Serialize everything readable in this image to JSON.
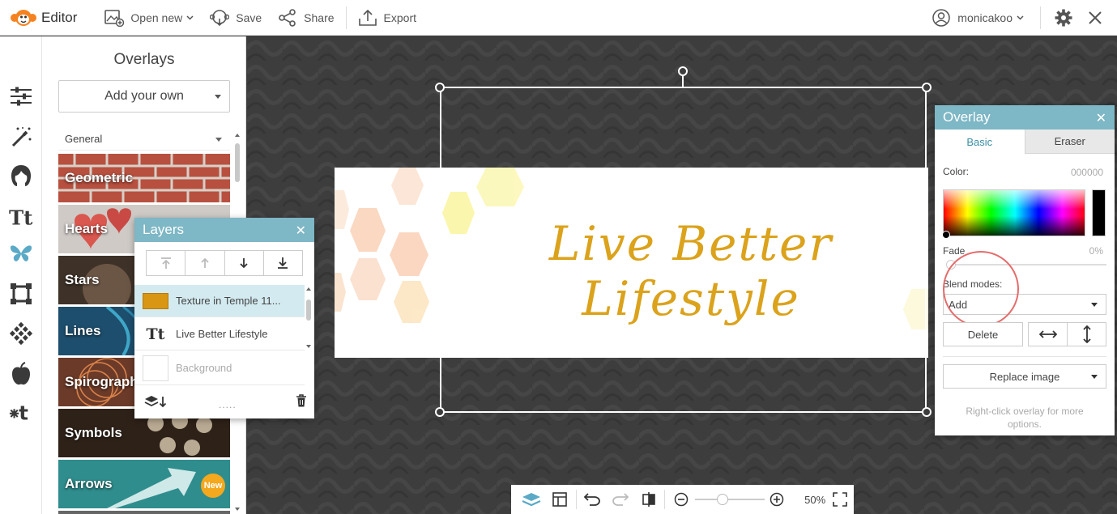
{
  "app": {
    "name": "Editor"
  },
  "toolbar": {
    "open_new": "Open new",
    "save": "Save",
    "share": "Share",
    "export": "Export",
    "username": "monicakoo"
  },
  "overlays_panel": {
    "title": "Overlays",
    "add_your_own": "Add your own",
    "category": "General",
    "tiles": [
      {
        "label": "Geometric",
        "badge": ""
      },
      {
        "label": "Hearts",
        "badge": ""
      },
      {
        "label": "Stars",
        "badge": ""
      },
      {
        "label": "Lines",
        "badge": ""
      },
      {
        "label": "Spirograph",
        "badge": ""
      },
      {
        "label": "Symbols",
        "badge": ""
      },
      {
        "label": "Arrows",
        "badge": "New"
      }
    ]
  },
  "layers_panel": {
    "title": "Layers",
    "items": [
      {
        "label": "Texture in Temple 11..."
      },
      {
        "label": "Live Better Lifestyle",
        "icon_text": "Tt"
      },
      {
        "label": "Background"
      }
    ],
    "handle": "....."
  },
  "canvas": {
    "script_text": "Live Better Lifestyle"
  },
  "overlay_panel": {
    "title": "Overlay",
    "tabs": [
      "Basic",
      "Eraser"
    ],
    "color_label": "Color:",
    "color_value": "000000",
    "fade_label": "Fade",
    "fade_value": "0%",
    "fade_level": 0,
    "blend_label": "Blend modes:",
    "blend_value": "Add",
    "delete_label": "Delete",
    "replace_label": "Replace image",
    "hint": "Right-click overlay for more options."
  },
  "bottom_bar": {
    "zoom": "50%",
    "zoom_level": 0.2
  },
  "colors": {
    "accent": "#7eb7c5",
    "highlight_circle": "#e56b6b",
    "script_gold": "#dba21b",
    "brand_orange": "#f58220"
  }
}
